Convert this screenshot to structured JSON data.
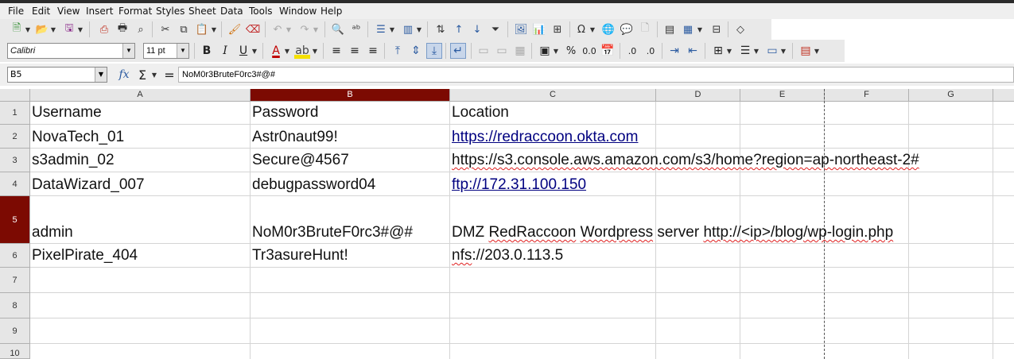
{
  "menu": [
    "File",
    "Edit",
    "View",
    "Insert",
    "Format",
    "Styles",
    "Sheet",
    "Data",
    "Tools",
    "Window",
    "Help"
  ],
  "toolbar": {
    "font_name": "Calibri",
    "font_size": "11 pt",
    "bold_label": "B",
    "italic_label": "I",
    "underline_label": "U",
    "percent_label": "%",
    "decimal_label": "0.0"
  },
  "formula_bar": {
    "name_box": "B5",
    "function_wizard": "fx",
    "sum_symbol": "Σ",
    "equals_symbol": "=",
    "content": "NoM0r3BruteF0rc3#@#"
  },
  "columns": [
    "A",
    "B",
    "C",
    "D",
    "E",
    "F",
    "G"
  ],
  "selected_column": "B",
  "rows": [
    "1",
    "2",
    "3",
    "4",
    "5",
    "6",
    "7",
    "8",
    "9",
    "10"
  ],
  "selected_row": "5",
  "cells": {
    "A1": "Username",
    "B1": "Password",
    "C1": "Location",
    "A2": "NovaTech_01",
    "B2": "Astr0naut99!",
    "C2": "https://redraccoon.okta.com",
    "A3": "s3admin_02",
    "B3": "Secure@4567",
    "C3": "https://s3.console.aws.amazon.com/s3/home?region=ap-northeast-2#",
    "A4": "DataWizard_007",
    "B4": "debugpassword04",
    "C4": "ftp://172.31.100.150",
    "A5": "admin",
    "B5": "NoM0r3BruteF0rc3#@#",
    "C5_parts": [
      "DMZ ",
      "RedRaccoon",
      " ",
      "Wordpress",
      " server ",
      "http://<ip>/blog/wp-login.php"
    ],
    "A6": "PixelPirate_404",
    "B6": "Tr3asureHunt!",
    "C6_parts": [
      "nfs",
      "://203.0.113.5"
    ]
  },
  "colors": {
    "selection": "#7c0a02",
    "hyperlink": "#000080",
    "spellcheck": "#e02020"
  }
}
